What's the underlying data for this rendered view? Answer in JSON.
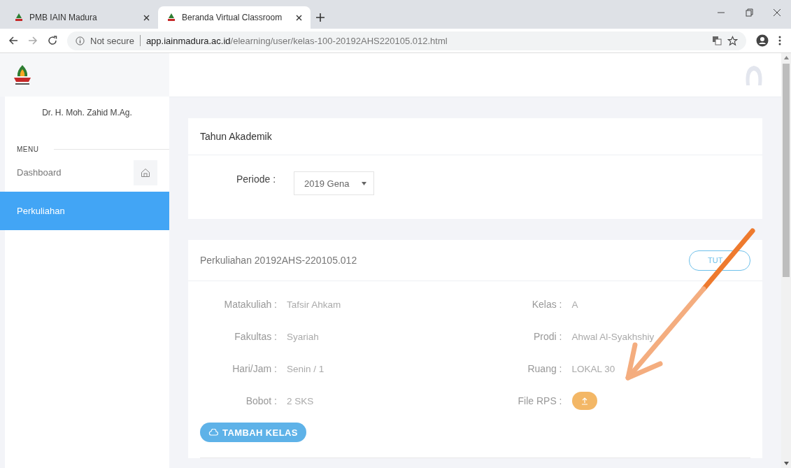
{
  "browser": {
    "tabs": [
      {
        "title": "PMB IAIN Madura",
        "selected": false
      },
      {
        "title": "Beranda Virtual Classroom",
        "selected": true
      }
    ],
    "url_prefix": "Not secure",
    "url_host": "app.iainmadura.ac.id",
    "url_path": "/elearning/user/kelas-100-20192AHS220105.012.html"
  },
  "sidebar": {
    "user_name": "Dr. H. Moh. Zahid M.Ag.",
    "menu_label": "MENU",
    "items": [
      {
        "label": "Dashboard",
        "selected": false,
        "kind": "with-icon"
      },
      {
        "label": "Perkuliahan",
        "selected": true,
        "kind": "plain"
      }
    ]
  },
  "academic_year": {
    "title": "Tahun Akademik",
    "period_label": "Periode :",
    "period_value": "2019 Gena"
  },
  "course": {
    "title": "Perkuliahan 20192AHS-220105.012",
    "close_button": "TUT",
    "left_fields": [
      {
        "label": "Matakuliah :",
        "value": "Tafsir Ahkam"
      },
      {
        "label": "Fakultas :",
        "value": "Syariah"
      },
      {
        "label": "Hari/Jam :",
        "value": "Senin / 1"
      },
      {
        "label": "Bobot :",
        "value": "2 SKS"
      }
    ],
    "right_fields": [
      {
        "label": "Kelas :",
        "value": "A",
        "kind": "text"
      },
      {
        "label": "Prodi :",
        "value": "Ahwal Al-Syakhshiy",
        "kind": "text"
      },
      {
        "label": "Ruang :",
        "value": "LOKAL 30",
        "kind": "text"
      },
      {
        "label": "File RPS :",
        "kind": "upload"
      }
    ],
    "add_button": "TAMBAH KELAS"
  }
}
